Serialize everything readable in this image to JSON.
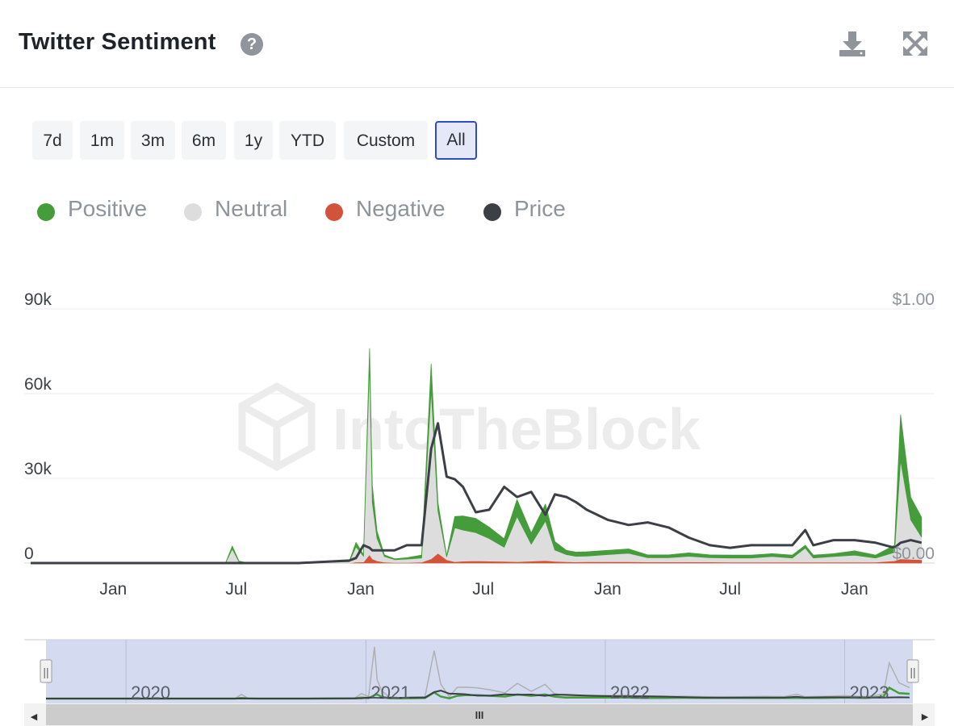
{
  "header": {
    "title": "Twitter Sentiment",
    "help_icon": "?"
  },
  "toolbar": {
    "download_icon": "download-icon",
    "expand_icon": "fullscreen-icon"
  },
  "ranges": [
    {
      "label": "7d",
      "active": false
    },
    {
      "label": "1m",
      "active": false
    },
    {
      "label": "3m",
      "active": false
    },
    {
      "label": "6m",
      "active": false
    },
    {
      "label": "1y",
      "active": false
    },
    {
      "label": "YTD",
      "active": false
    },
    {
      "label": "Custom",
      "active": false
    },
    {
      "label": "All",
      "active": true
    }
  ],
  "legend": [
    {
      "label": "Positive",
      "color": "#459c3a"
    },
    {
      "label": "Neutral",
      "color": "#dddddd"
    },
    {
      "label": "Negative",
      "color": "#d3533a"
    },
    {
      "label": "Price",
      "color": "#3c4046"
    }
  ],
  "watermark": "IntoTheBlock",
  "chart_data": {
    "type": "area",
    "x_axis": {
      "type": "date",
      "ticks": [
        "Jan",
        "Jul",
        "Jan",
        "Jul",
        "Jan",
        "Jul",
        "Jan"
      ],
      "tick_dates": [
        "2020-01-01",
        "2020-07-01",
        "2021-01-01",
        "2021-07-01",
        "2022-01-01",
        "2022-07-01",
        "2023-01-01"
      ],
      "range": [
        "2019-09-01",
        "2023-04-15"
      ]
    },
    "y_axis_left": {
      "ticks": [
        "0",
        "30k",
        "60k",
        "90k"
      ],
      "tick_values": [
        0,
        30000,
        60000,
        90000
      ],
      "range": [
        0,
        90000
      ]
    },
    "y_axis_right": {
      "ticks": [
        "$0.00",
        "$1.00"
      ],
      "tick_values": [
        0,
        1
      ],
      "range": [
        0,
        1
      ]
    },
    "stacking": "normal",
    "dates": [
      "2019-09-01",
      "2019-12-01",
      "2020-03-01",
      "2020-06-15",
      "2020-06-25",
      "2020-07-05",
      "2020-07-20",
      "2020-10-01",
      "2020-12-15",
      "2020-12-25",
      "2021-01-05",
      "2021-01-14",
      "2021-01-18",
      "2021-01-25",
      "2021-02-05",
      "2021-02-20",
      "2021-03-10",
      "2021-04-01",
      "2021-04-15",
      "2021-04-25",
      "2021-05-08",
      "2021-05-20",
      "2021-06-01",
      "2021-06-20",
      "2021-07-10",
      "2021-08-01",
      "2021-08-20",
      "2021-09-10",
      "2021-10-01",
      "2021-10-15",
      "2021-11-01",
      "2021-11-15",
      "2021-12-01",
      "2022-01-01",
      "2022-02-01",
      "2022-03-01",
      "2022-04-01",
      "2022-05-01",
      "2022-06-01",
      "2022-07-01",
      "2022-08-01",
      "2022-09-01",
      "2022-10-01",
      "2022-10-20",
      "2022-11-01",
      "2022-12-01",
      "2023-01-01",
      "2023-02-01",
      "2023-03-01",
      "2023-03-10",
      "2023-03-25",
      "2023-04-10"
    ],
    "series": [
      {
        "name": "Negative",
        "values": [
          0,
          0,
          0,
          0,
          0,
          0,
          0,
          0,
          0,
          300,
          400,
          3000,
          1500,
          800,
          300,
          200,
          200,
          300,
          1500,
          3500,
          1200,
          500,
          700,
          800,
          700,
          600,
          500,
          700,
          900,
          600,
          500,
          400,
          500,
          500,
          500,
          400,
          400,
          400,
          400,
          300,
          300,
          300,
          300,
          300,
          300,
          300,
          300,
          300,
          800,
          1500,
          1300,
          1200
        ]
      },
      {
        "name": "Neutral",
        "values": [
          0,
          0,
          0,
          0,
          5000,
          500,
          0,
          0,
          500,
          5500,
          2000,
          68000,
          20000,
          8000,
          2000,
          1000,
          1200,
          1500,
          60000,
          15000,
          1000,
          12000,
          11000,
          10000,
          8000,
          5000,
          16000,
          6000,
          14000,
          4000,
          2500,
          2000,
          2000,
          2500,
          3000,
          1500,
          1500,
          2000,
          1500,
          1500,
          1500,
          2000,
          1500,
          5000,
          1500,
          2000,
          2500,
          1500,
          3000,
          35000,
          14000,
          8000
        ]
      },
      {
        "name": "Positive",
        "values": [
          0,
          0,
          0,
          0,
          1000,
          200,
          0,
          0,
          200,
          1500,
          600,
          5000,
          6000,
          2500,
          600,
          300,
          500,
          1000,
          9000,
          3000,
          400,
          4000,
          5000,
          5000,
          4000,
          3000,
          6000,
          4000,
          6000,
          3000,
          1500,
          1500,
          1500,
          1500,
          1500,
          1000,
          1000,
          1200,
          1000,
          1000,
          1000,
          1000,
          1000,
          1000,
          1000,
          1000,
          1500,
          1000,
          2500,
          16000,
          8000,
          7000
        ]
      },
      {
        "name": "Price",
        "values": [
          0,
          0,
          0,
          0,
          0,
          0,
          0,
          0,
          0.01,
          0.02,
          0.07,
          0.06,
          0.05,
          0.05,
          0.05,
          0.05,
          0.07,
          0.07,
          0.45,
          0.55,
          0.34,
          0.33,
          0.3,
          0.2,
          0.21,
          0.3,
          0.26,
          0.28,
          0.19,
          0.27,
          0.26,
          0.24,
          0.21,
          0.17,
          0.15,
          0.16,
          0.14,
          0.1,
          0.07,
          0.06,
          0.07,
          0.07,
          0.07,
          0.13,
          0.07,
          0.09,
          0.09,
          0.08,
          0.06,
          0.08,
          0.09,
          0.08
        ]
      }
    ],
    "grid": true,
    "legend_position": "top-left"
  },
  "navigator": {
    "years": [
      "2020",
      "2021",
      "2022",
      "2023"
    ],
    "year_dates": [
      "2020-01-01",
      "2021-01-01",
      "2022-01-01",
      "2023-01-01"
    ],
    "handle_glyph": "||",
    "scroll_glyph": "III",
    "left_arrow": "◀",
    "right_arrow": "▶",
    "selected_range": [
      "2019-09-01",
      "2023-04-15"
    ]
  }
}
